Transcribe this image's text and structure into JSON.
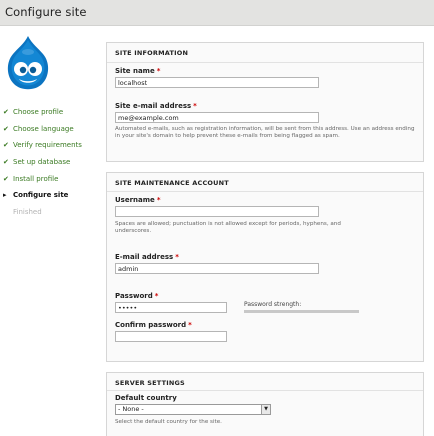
{
  "header": {
    "title": "Configure site"
  },
  "logo": {
    "icon": "drupal-drop-icon",
    "color": "#0077c0"
  },
  "steps": [
    {
      "label": "Choose profile",
      "state": "done"
    },
    {
      "label": "Choose language",
      "state": "done"
    },
    {
      "label": "Verify requirements",
      "state": "done"
    },
    {
      "label": "Set up database",
      "state": "done"
    },
    {
      "label": "Install profile",
      "state": "done"
    },
    {
      "label": "Configure site",
      "state": "active"
    },
    {
      "label": "Finished",
      "state": "pending"
    }
  ],
  "site_information": {
    "legend": "SITE INFORMATION",
    "site_name": {
      "label": "Site name",
      "required": "*",
      "value": "localhost"
    },
    "site_email": {
      "label": "Site e-mail address",
      "required": "*",
      "value": "me@example.com",
      "description": "Automated e-mails, such as registration information, will be sent from this address. Use an address ending in your site's domain to help prevent these e-mails from being flagged as spam."
    }
  },
  "maintenance_account": {
    "legend": "SITE MAINTENANCE ACCOUNT",
    "username": {
      "label": "Username",
      "required": "*",
      "value": "",
      "description": "Spaces are allowed; punctuation is not allowed except for periods, hyphens, and underscores."
    },
    "email": {
      "label": "E-mail address",
      "required": "*",
      "value": "admin"
    },
    "password": {
      "label": "Password",
      "required": "*",
      "value": "•••••"
    },
    "password_strength": {
      "label": "Password strength:",
      "level": 0
    },
    "confirm_password": {
      "label": "Confirm password",
      "required": "*",
      "value": ""
    }
  },
  "server_settings": {
    "legend": "SERVER SETTINGS",
    "default_country": {
      "label": "Default country",
      "selected": "- None -",
      "description": "Select the default country for the site."
    }
  }
}
